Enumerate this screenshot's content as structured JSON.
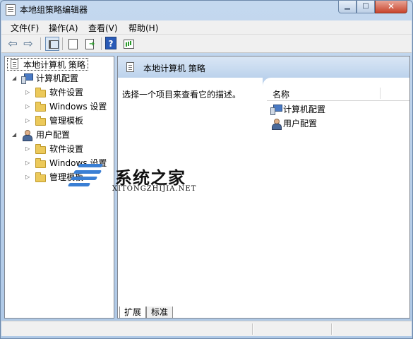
{
  "window": {
    "title": "本地组策略编辑器"
  },
  "menu": {
    "items": [
      "文件(F)",
      "操作(A)",
      "查看(V)",
      "帮助(H)"
    ]
  },
  "tree": {
    "root": "本地计算机 策略",
    "computer": {
      "label": "计算机配置",
      "children": [
        "软件设置",
        "Windows 设置",
        "管理模板"
      ]
    },
    "user": {
      "label": "用户配置",
      "children": [
        "软件设置",
        "Windows 设置",
        "管理模板"
      ]
    }
  },
  "detail": {
    "header": "本地计算机 策略",
    "description": "选择一个项目来查看它的描述。",
    "column_name": "名称",
    "items": [
      "计算机配置",
      "用户配置"
    ],
    "tabs": [
      "扩展",
      "标准"
    ]
  },
  "watermark": {
    "title": "系统之家",
    "subtitle": "XITONGZHIJIA.NET"
  },
  "colors": {
    "title_bar": "#b9d1ea",
    "header_gradient": "#bcd2ec",
    "close_button": "#c8442c"
  },
  "icons": {
    "back": "arrow-left-icon",
    "forward": "arrow-right-icon",
    "tree_toggle": "console-tree-icon",
    "properties": "properties-icon",
    "export": "export-list-icon",
    "help": "help-icon",
    "pane_toggle": "action-pane-icon"
  }
}
